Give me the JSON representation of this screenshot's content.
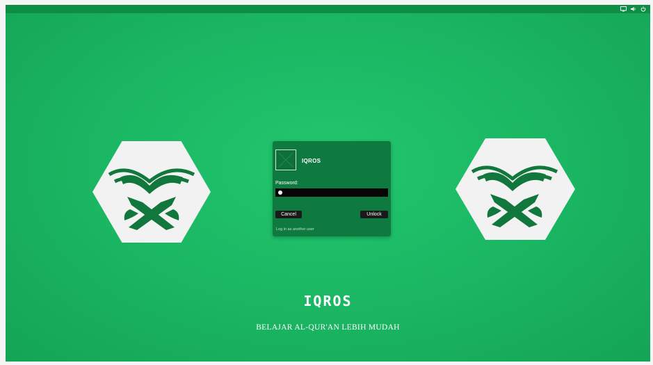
{
  "system_tray": {
    "icons": [
      "monitor-icon",
      "volume-icon",
      "power-icon"
    ]
  },
  "login_dialog": {
    "username": "IQROS",
    "password_label": "Password:",
    "cancel_label": "Cancel",
    "unlock_label": "Unlock",
    "switch_user_label": "Log in as another user"
  },
  "branding": {
    "title": "IQROS",
    "tagline": "BELAJAR AL-QUR'AN LEBIH MUDAH",
    "logo_icon": "quran-on-rehal-icon"
  },
  "colors": {
    "background_green": "#1ab562",
    "dialog_green": "#0f7a3f",
    "logo_green": "#12773c",
    "hexagon_fill": "#f1f2f1"
  }
}
